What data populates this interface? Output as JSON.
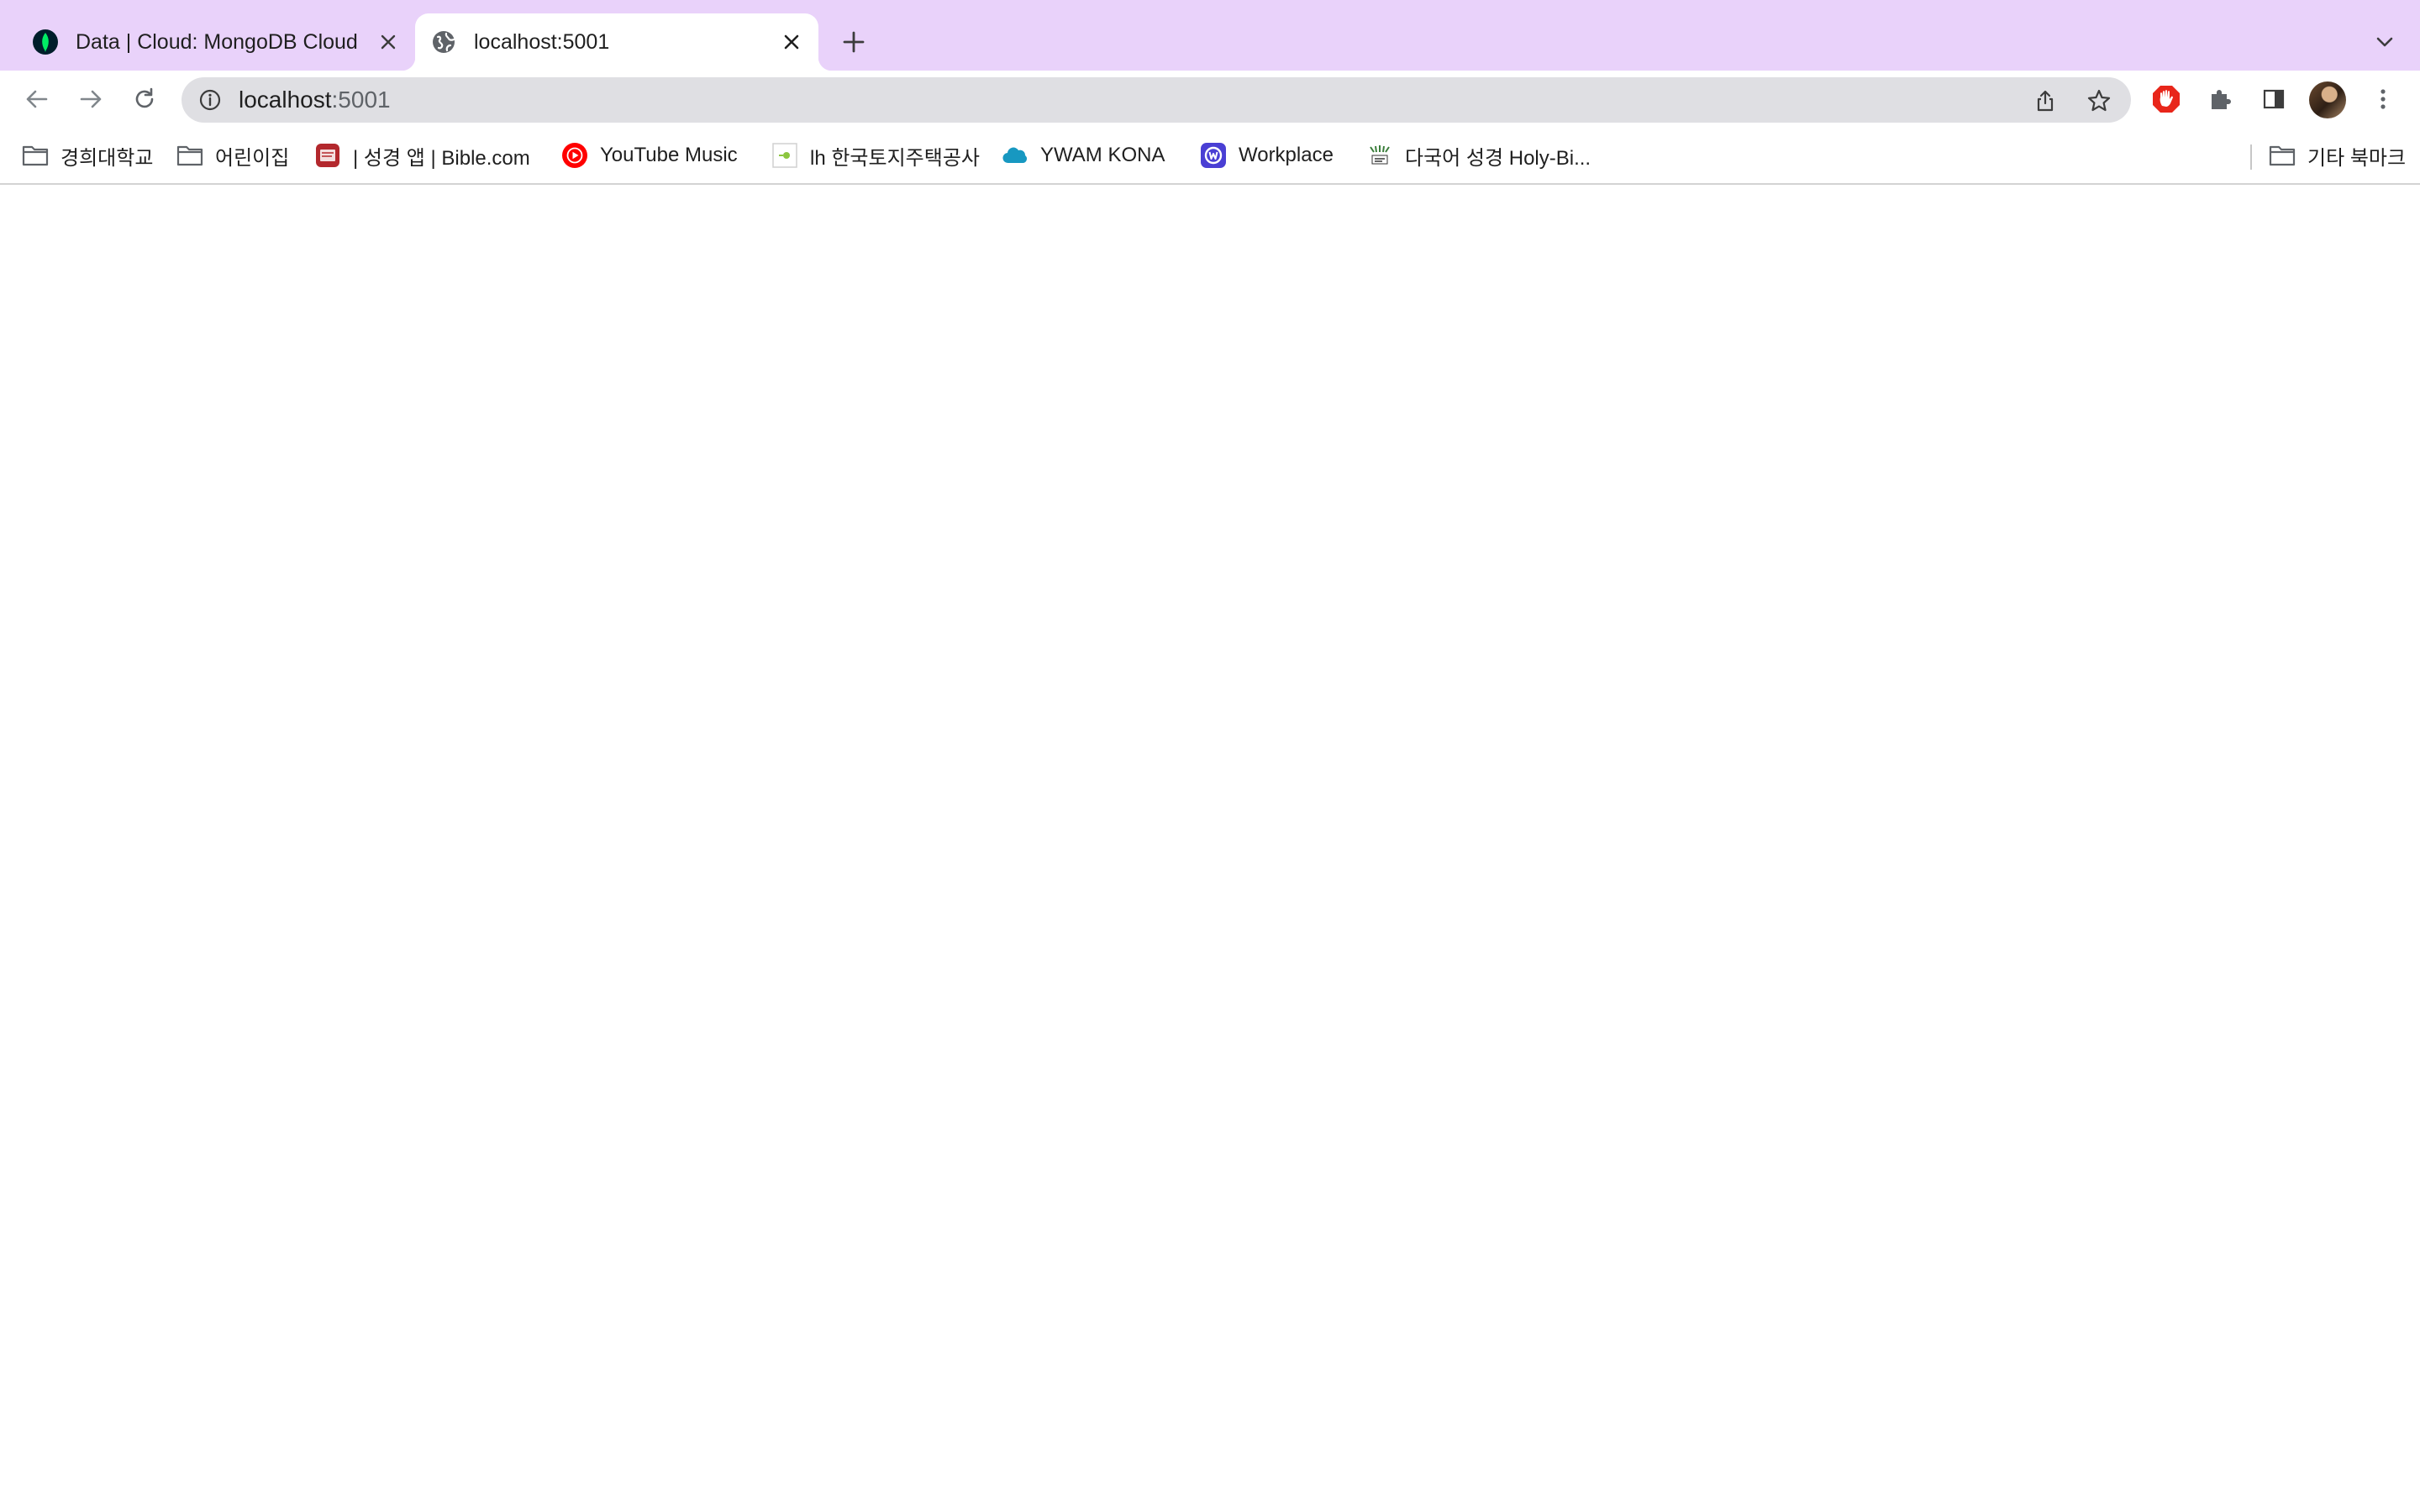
{
  "tabs": [
    {
      "title": "Data | Cloud: MongoDB Cloud",
      "favicon": "mongodb-leaf-icon",
      "active": false
    },
    {
      "title": "localhost:5001",
      "favicon": "globe-icon",
      "active": true
    }
  ],
  "omnibox": {
    "host": "localhost",
    "port": ":5001"
  },
  "bookmarks": [
    {
      "label": "경희대학교",
      "icon": "folder-icon"
    },
    {
      "label": "어린이집",
      "icon": "folder-icon"
    },
    {
      "label": "| 성경 앱 | Bible.com",
      "icon": "bible-icon"
    },
    {
      "label": "YouTube Music",
      "icon": "youtube-music-icon"
    },
    {
      "label": "lh 한국토지주택공사",
      "icon": "lh-icon"
    },
    {
      "label": "YWAM KONA",
      "icon": "cloud-icon"
    },
    {
      "label": "Workplace",
      "icon": "workplace-icon"
    },
    {
      "label": "다국어 성경 Holy-Bi...",
      "icon": "holy-bible-icon"
    }
  ],
  "other_bookmarks": {
    "label": "기타 북마크",
    "icon": "folder-icon"
  },
  "colors": {
    "tabstrip": "#e9d2fa",
    "omnibox": "#dfdfe3",
    "adblock_red": "#e8261a",
    "youtube_red": "#ff0000",
    "workplace_blue": "#4a3fd4",
    "mongodb_green": "#00ed64"
  }
}
